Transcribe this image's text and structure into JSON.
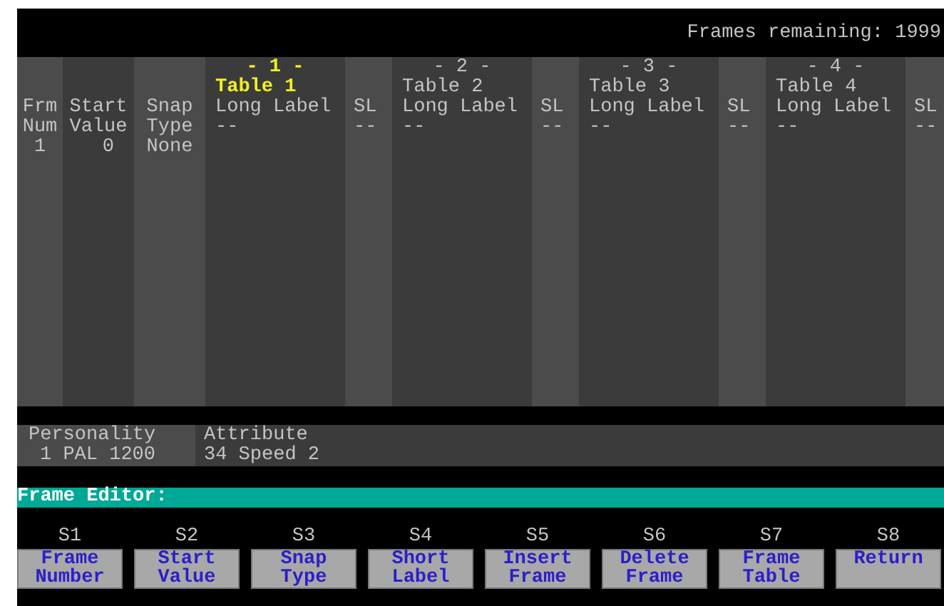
{
  "status_bar": {
    "frames_remaining": "Frames remaining: 1999"
  },
  "fixed_columns": [
    {
      "header": [
        "Frm",
        "Num"
      ],
      "value": "1"
    },
    {
      "header": [
        "Start",
        "Value"
      ],
      "value": "0"
    },
    {
      "header": [
        "Snap",
        "Type"
      ],
      "value": "None"
    }
  ],
  "tables": [
    {
      "number": "- 1 -",
      "name": "Table 1",
      "long_label": "Long Label",
      "long_value": "--",
      "short_label": "SL",
      "short_value": "--",
      "selected": true
    },
    {
      "number": "- 2 -",
      "name": "Table 2",
      "long_label": "Long Label",
      "long_value": "--",
      "short_label": "SL",
      "short_value": "--",
      "selected": false
    },
    {
      "number": "- 3 -",
      "name": "Table 3",
      "long_label": "Long Label",
      "long_value": "--",
      "short_label": "SL",
      "short_value": "--",
      "selected": false
    },
    {
      "number": "- 4 -",
      "name": "Table 4",
      "long_label": "Long Label",
      "long_value": "--",
      "short_label": "SL",
      "short_value": "--",
      "selected": false
    }
  ],
  "info_panel": {
    "personality_label": "Personality",
    "personality_value": "1 PAL 1200",
    "attribute_label": "Attribute",
    "attribute_value": "34 Speed 2"
  },
  "prompt": "Frame Editor:",
  "softkeys": [
    {
      "key": "S1",
      "label": [
        "Frame",
        "Number"
      ]
    },
    {
      "key": "S2",
      "label": [
        "Start",
        "Value"
      ]
    },
    {
      "key": "S3",
      "label": [
        "Snap",
        "Type"
      ]
    },
    {
      "key": "S4",
      "label": [
        "Short",
        "Label"
      ]
    },
    {
      "key": "S5",
      "label": [
        "Insert",
        "Frame"
      ]
    },
    {
      "key": "S6",
      "label": [
        "Delete",
        "Frame"
      ]
    },
    {
      "key": "S7",
      "label": [
        "Frame",
        "Table"
      ]
    },
    {
      "key": "S8",
      "label": [
        "Return"
      ]
    }
  ]
}
